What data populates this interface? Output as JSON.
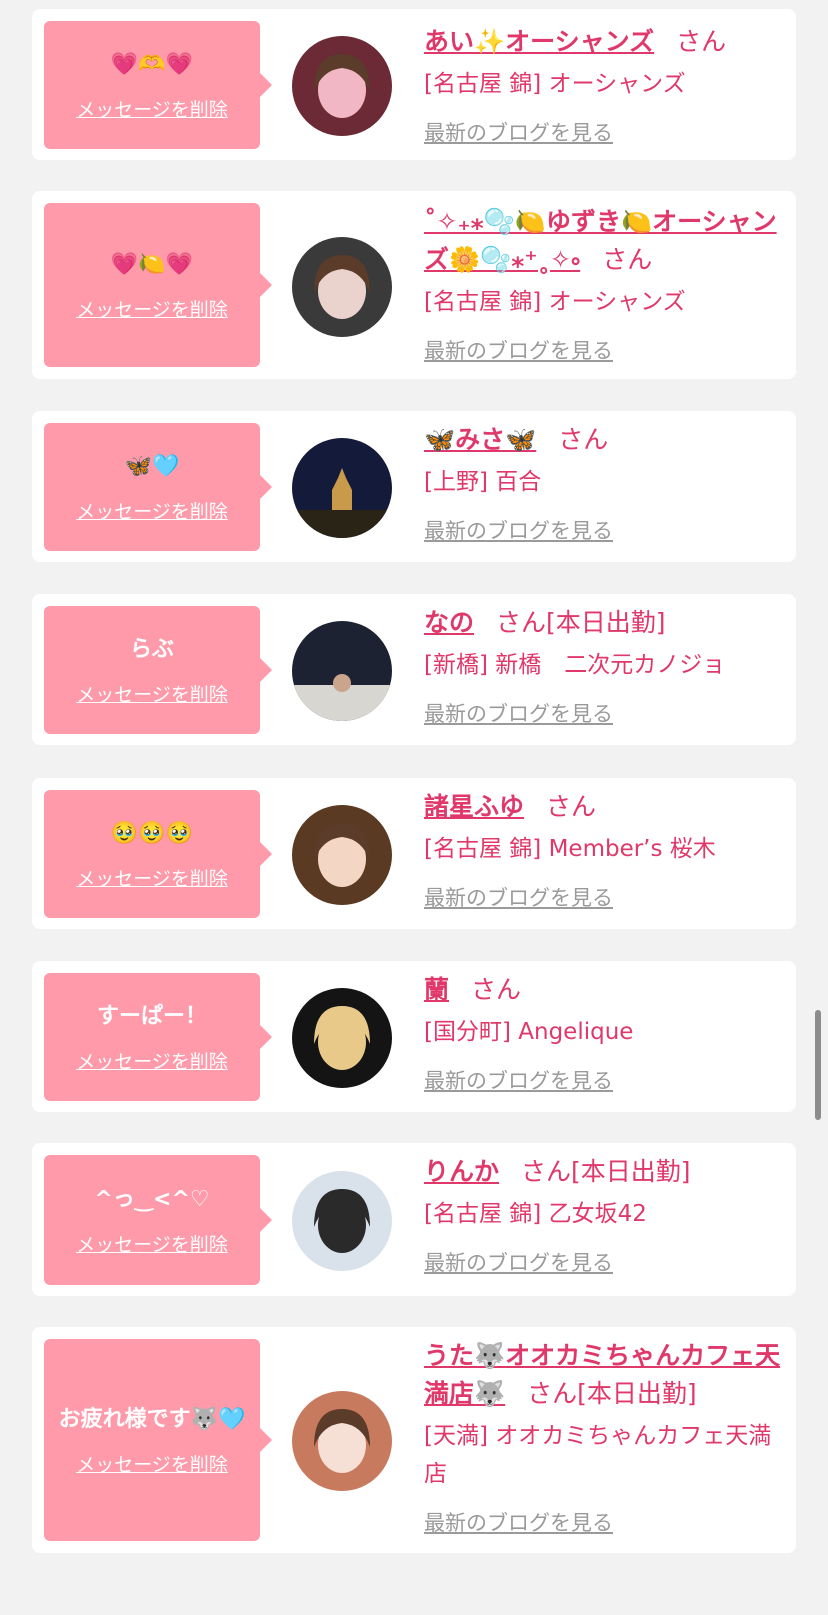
{
  "entries": [
    {
      "message": "💗🫶💗",
      "delete_label": "メッセージを削除",
      "name": "あい✨オーシャンズ",
      "san": "さん",
      "attendance": "",
      "shop": "[名古屋 錦] オーシャンズ",
      "blog_label": "最新のブログを見る",
      "avatar_icon": "girl-photo-avatar",
      "avatar_colors": [
        "#6b2a35",
        "#f2b7c4"
      ]
    },
    {
      "message": "💗🍋💗",
      "delete_label": "メッセージを削除",
      "name": "˚✧₊⁎🫧🍋ゆずき🍋オーシャンズ🌼🫧⁎⁺˳✧༚",
      "san": "さん",
      "attendance": "",
      "shop": "[名古屋 錦] オーシャンズ",
      "blog_label": "最新のブログを見る",
      "avatar_icon": "girl-photo-avatar",
      "avatar_colors": [
        "#3a3a3a",
        "#e9d3cc"
      ]
    },
    {
      "message": "🦋🩵",
      "delete_label": "メッセージを削除",
      "name": "🦋みさ🦋",
      "san": "さん",
      "attendance": "",
      "shop": "[上野] 百合",
      "blog_label": "最新のブログを見る",
      "avatar_icon": "night-castle-avatar",
      "avatar_colors": [
        "#141a3a",
        "#c89a4a"
      ]
    },
    {
      "message": "らぶ",
      "delete_label": "メッセージを削除",
      "name": "なの",
      "san": "さん",
      "attendance": "[本日出勤]",
      "shop": "[新橋] 新橋　二次元カノジョ",
      "blog_label": "最新のブログを見る",
      "avatar_icon": "stage-photo-avatar",
      "avatar_colors": [
        "#1d2233",
        "#d8d6d0"
      ]
    },
    {
      "message": "🥹🥹🥹",
      "delete_label": "メッセージを削除",
      "name": "諸星ふゆ",
      "san": "さん",
      "attendance": "",
      "shop": "[名古屋 錦] Member’s 桜木",
      "blog_label": "最新のブログを見る",
      "avatar_icon": "girl-photo-avatar",
      "avatar_colors": [
        "#5a3a22",
        "#f3d6c4"
      ]
    },
    {
      "message": "すーぱー！",
      "delete_label": "メッセージを削除",
      "name": "蘭",
      "san": "さん",
      "attendance": "",
      "shop": "[国分町] Angelique",
      "blog_label": "最新のブログを見る",
      "avatar_icon": "maid-photo-avatar",
      "avatar_colors": [
        "#141414",
        "#e8c98a"
      ]
    },
    {
      "message": "^っ‿<^♡",
      "delete_label": "メッセージを削除",
      "name": "りんか",
      "san": "さん",
      "attendance": "[本日出勤]",
      "shop": "[名古屋 錦] 乙女坂42",
      "blog_label": "最新のブログを見る",
      "avatar_icon": "girl-photo-avatar",
      "avatar_colors": [
        "#d9e2ea",
        "#2a2a2a"
      ]
    },
    {
      "message": "お疲れ様です🐺🩵",
      "delete_label": "メッセージを削除",
      "name": "うた🐺オオカミちゃんカフェ天満店🐺",
      "san": "さん",
      "attendance": "[本日出勤]",
      "shop": "[天満] オオカミちゃんカフェ天満店",
      "blog_label": "最新のブログを見る",
      "avatar_icon": "girl-photo-avatar",
      "avatar_colors": [
        "#c87a5e",
        "#f6e0d6"
      ]
    }
  ]
}
